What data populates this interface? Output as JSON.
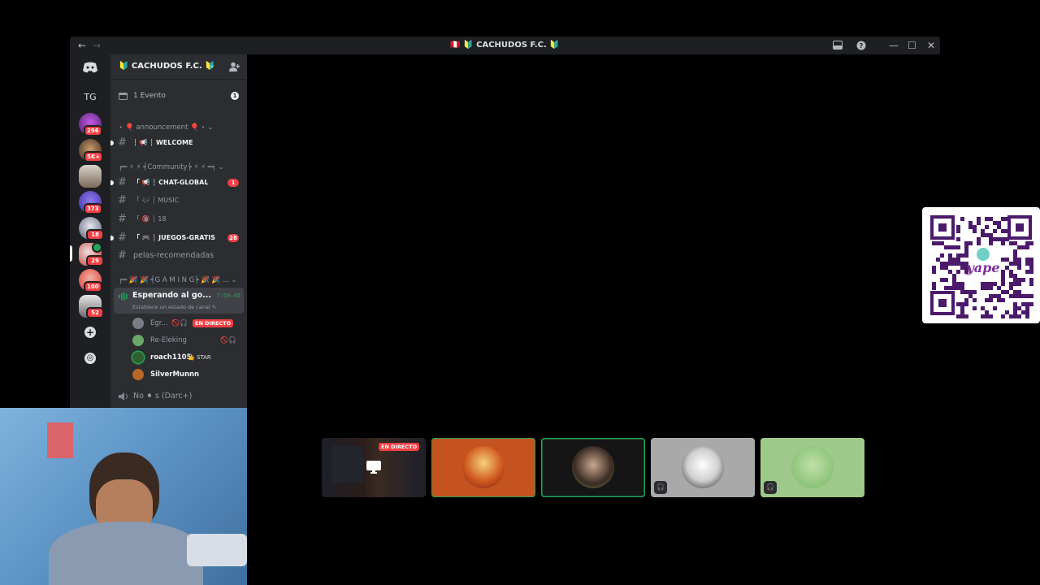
{
  "window": {
    "title": "🇵🇪 🔰 CACHUDOS F.C. 🔰",
    "nav_back": "←",
    "nav_forward": "→",
    "inbox_icon": "inbox-icon",
    "help_icon": "help-icon",
    "minimize": "—",
    "maximize": "☐",
    "close": "✕"
  },
  "guilds": {
    "home_icon": "discord-logo-icon",
    "folder_label": "TG",
    "badges": [
      "296",
      "5K+",
      "",
      "373",
      "18",
      "29",
      "100",
      "52"
    ],
    "add_server": "+",
    "explore": "◎"
  },
  "server": {
    "name": "🔰 CACHUDOS F.C. 🔰",
    "chevron": "⌄",
    "invite_icon": "add-member-icon"
  },
  "events": {
    "label": "1 Evento",
    "count": "1"
  },
  "categories": {
    "announcement": "⋆ 🎈 announcement 🎈 ⋆ ⌄",
    "community": "╒═ ⚡ ⚡ ╡Community╞ ⚡ ⚡ ═╕ ⌄",
    "gaming": "╒═ 🎉 🎉 ╡G A M I N G╞ 🎉 🎉 ... ⌄"
  },
  "channels": {
    "welcome": "┆ 📢 ┆ WELCOME",
    "chat_global": "「 📢 ┆ CHAT-GLOBAL",
    "chat_global_count": "1",
    "music": "「 🎶 ┆ MUSIC",
    "eighteen": "「 🔞 ┆ 18",
    "juegos": "「 🎮 ┆ JUEGOS-GRATIS",
    "juegos_count": "28",
    "pelas": "pelas-recomendadas"
  },
  "voice": {
    "channel_name": "Esperando al go...",
    "timer": "7:58:45",
    "status_hint": "Establece un estado de canal ✎",
    "users": [
      {
        "name": "Egr...",
        "live": "EN DIRECTO",
        "color": "#7a7d85"
      },
      {
        "name": "Re-Eleking",
        "color": "#6aa86a"
      },
      {
        "name": "roach1105",
        "tag": "👍 STAR",
        "color": "#2f5f30"
      },
      {
        "name": "SilverMunnn",
        "color": "#b8662a"
      }
    ],
    "other_channel": "No ⚫ s (Darc+)"
  },
  "stage": {
    "tiles": [
      {
        "label": "EN DIRECTO",
        "kind": "stream",
        "bg": "#1a1b1e"
      },
      {
        "kind": "avatar",
        "bg": "#c5531f",
        "ring": "#e8b04a"
      },
      {
        "kind": "avatar",
        "bg": "#151515",
        "ring": "#6b8a4a"
      },
      {
        "kind": "avatar",
        "bg": "#a9a9a9",
        "ring": "#e8e8e8"
      },
      {
        "kind": "avatar",
        "bg": "#9fc98a",
        "ring": "#8cc47a"
      }
    ]
  },
  "qr": {
    "brand": "yape"
  },
  "colors": {
    "accent_red": "#f23f43",
    "green_speaking": "#23a55a",
    "sidebar": "#2b2d31",
    "rail": "#1e1f22"
  }
}
